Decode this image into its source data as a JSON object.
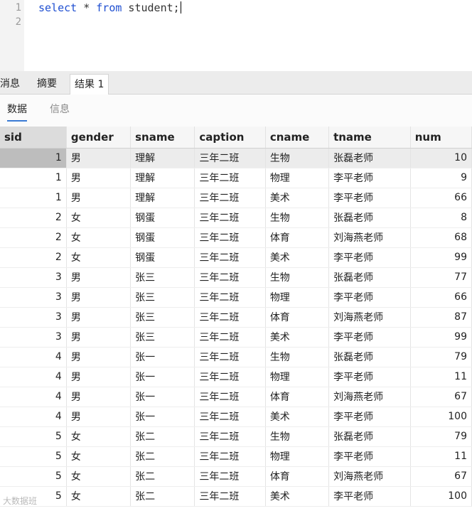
{
  "editor": {
    "line_numbers": [
      "1",
      "2"
    ],
    "code": {
      "kw1": "select",
      "mid": " * ",
      "kw2": "from",
      "rest": " student;"
    }
  },
  "tabs": [
    {
      "label": "消息",
      "active": false
    },
    {
      "label": "摘要",
      "active": false
    },
    {
      "label": "结果 1",
      "active": true
    }
  ],
  "subtabs": [
    {
      "label": "数据",
      "active": true
    },
    {
      "label": "信息",
      "active": false
    }
  ],
  "columns": [
    "sid",
    "gender",
    "sname",
    "caption",
    "cname",
    "tname",
    "num"
  ],
  "rows": [
    [
      "1",
      "男",
      "理解",
      "三年二班",
      "生物",
      "张磊老师",
      "10"
    ],
    [
      "1",
      "男",
      "理解",
      "三年二班",
      "物理",
      "李平老师",
      "9"
    ],
    [
      "1",
      "男",
      "理解",
      "三年二班",
      "美术",
      "李平老师",
      "66"
    ],
    [
      "2",
      "女",
      "钢蛋",
      "三年二班",
      "生物",
      "张磊老师",
      "8"
    ],
    [
      "2",
      "女",
      "钢蛋",
      "三年二班",
      "体育",
      "刘海燕老师",
      "68"
    ],
    [
      "2",
      "女",
      "钢蛋",
      "三年二班",
      "美术",
      "李平老师",
      "99"
    ],
    [
      "3",
      "男",
      "张三",
      "三年二班",
      "生物",
      "张磊老师",
      "77"
    ],
    [
      "3",
      "男",
      "张三",
      "三年二班",
      "物理",
      "李平老师",
      "66"
    ],
    [
      "3",
      "男",
      "张三",
      "三年二班",
      "体育",
      "刘海燕老师",
      "87"
    ],
    [
      "3",
      "男",
      "张三",
      "三年二班",
      "美术",
      "李平老师",
      "99"
    ],
    [
      "4",
      "男",
      "张一",
      "三年二班",
      "生物",
      "张磊老师",
      "79"
    ],
    [
      "4",
      "男",
      "张一",
      "三年二班",
      "物理",
      "李平老师",
      "11"
    ],
    [
      "4",
      "男",
      "张一",
      "三年二班",
      "体育",
      "刘海燕老师",
      "67"
    ],
    [
      "4",
      "男",
      "张一",
      "三年二班",
      "美术",
      "李平老师",
      "100"
    ],
    [
      "5",
      "女",
      "张二",
      "三年二班",
      "生物",
      "张磊老师",
      "79"
    ],
    [
      "5",
      "女",
      "张二",
      "三年二班",
      "物理",
      "李平老师",
      "11"
    ],
    [
      "5",
      "女",
      "张二",
      "三年二班",
      "体育",
      "刘海燕老师",
      "67"
    ],
    [
      "5",
      "女",
      "张二",
      "三年二班",
      "美术",
      "李平老师",
      "100"
    ]
  ],
  "watermark": "大数据班",
  "colors": {
    "keyword": "#1f4fd1",
    "active_subtab_underline": "#3a7bd5",
    "selected_cell": "#c8c8c8"
  }
}
